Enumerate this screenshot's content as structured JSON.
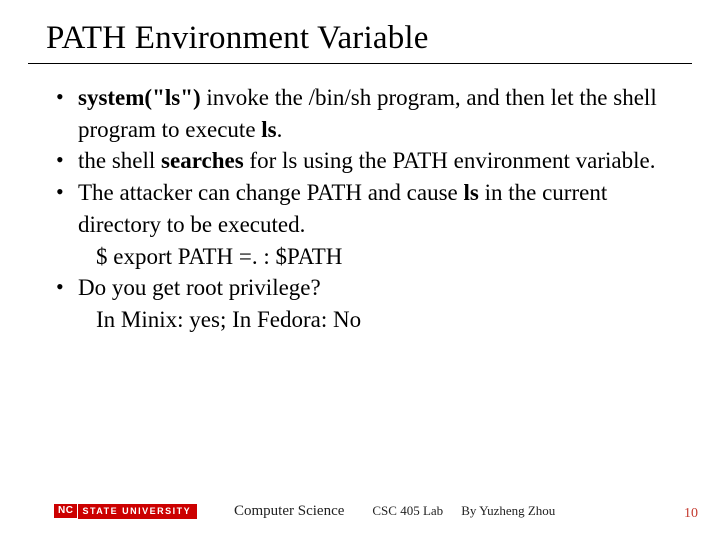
{
  "title": "PATH Environment Variable",
  "bullets": [
    {
      "html": "<b>system(\"ls\")</b> invoke the /bin/sh program, and then let the shell program to execute <b>ls</b>."
    },
    {
      "html": "the shell <b>searches</b> for ls using the PATH environment variable."
    },
    {
      "html": "The attacker can change PATH and cause <b>ls</b> in the current directory to be executed.",
      "sub": "$ export PATH =. : $PATH"
    },
    {
      "html": "Do you get root privilege?",
      "sub": "In Minix: yes; In Fedora: No"
    }
  ],
  "footer": {
    "logo_nc": "NC",
    "logo_state": "STATE UNIVERSITY",
    "department": "Computer Science",
    "course": "CSC 405 Lab",
    "author": "By Yuzheng Zhou",
    "page": "10"
  }
}
